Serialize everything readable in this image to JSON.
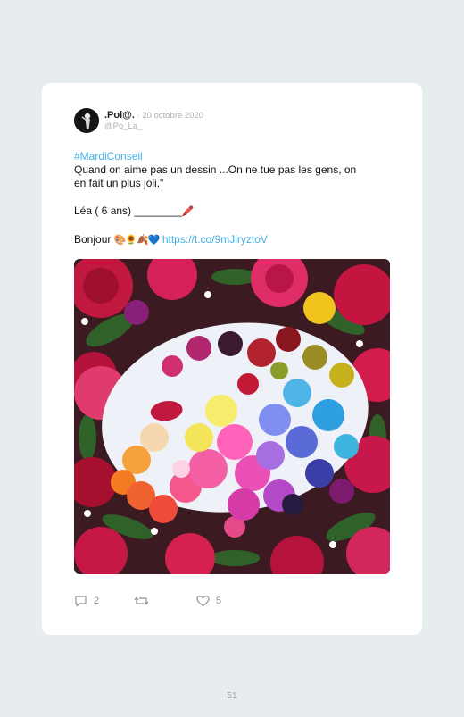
{
  "tweet": {
    "display_name": ".Pol@.",
    "meta": " · 20 octobre 2020",
    "handle": "@Po_La_",
    "hashtag": "#MardiConseil",
    "line1": "Quand on aime pas un dessin ...On ne tue pas les gens, on",
    "line2": "en fait un plus joli.\"",
    "signature": "Léa ( 6 ans) ________",
    "signature_emoji": "🖍️",
    "bonjour": "Bonjour ",
    "bonjour_emoji": "🎨🌻🍂💙",
    "link": "https://t.co/9mJlryztoV",
    "image_alt": "Palette de peinture sur un lit de roses"
  },
  "actions": {
    "reply_count": "2",
    "retweet_count": "",
    "like_count": "5"
  },
  "page_number": "51",
  "colors": {
    "background": "#e7ecee",
    "card": "#ffffff",
    "link": "#42b0e6",
    "muted": "#a8b0b4"
  }
}
